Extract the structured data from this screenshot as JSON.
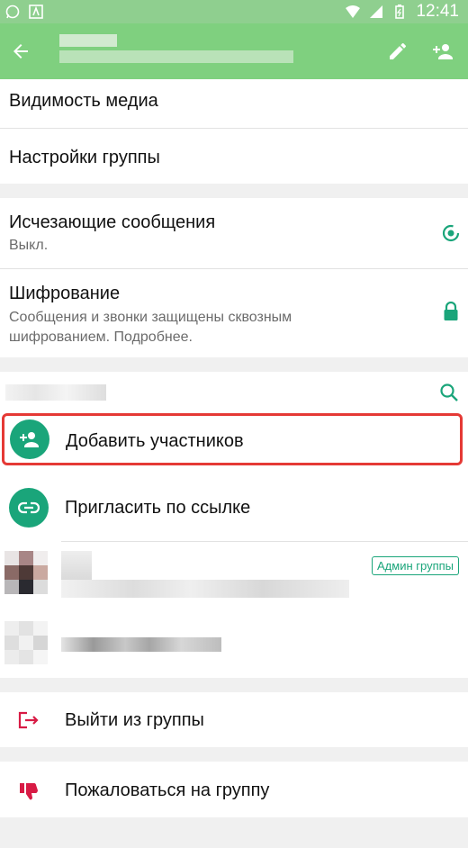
{
  "statusbar": {
    "time": "12:41"
  },
  "toolbar": {
    "back": "←"
  },
  "items": {
    "media": "Видимость медиа",
    "group_settings": "Настройки группы",
    "disappearing_title": "Исчезающие сообщения",
    "disappearing_sub": "Выкл.",
    "encryption_title": "Шифрование",
    "encryption_sub": "Сообщения и звонки защищены сквозным шифрованием. Подробнее."
  },
  "participants": {
    "add": "Добавить участников",
    "invite": "Пригласить по ссылке",
    "admin_badge": "Админ группы"
  },
  "actions": {
    "leave": "Выйти из группы",
    "report": "Пожаловаться на группу"
  },
  "colors": {
    "accent": "#1aa57a",
    "danger": "#d81b45",
    "appbar": "#7fd07f",
    "highlight": "#e53935"
  }
}
